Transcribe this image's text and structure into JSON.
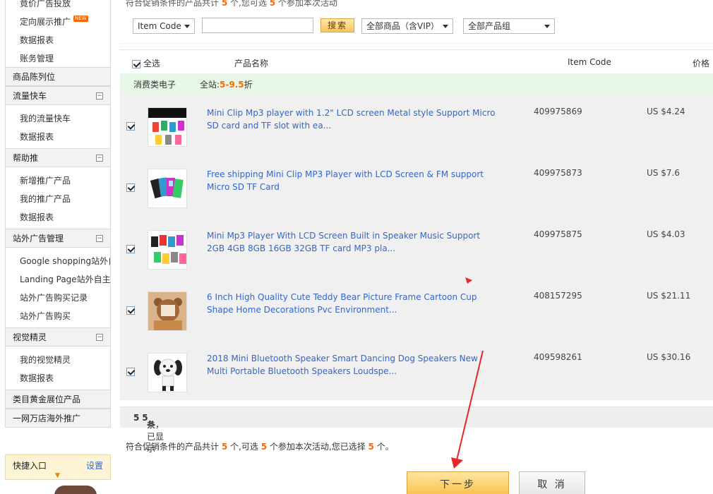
{
  "sidebar": {
    "top_items": [
      "竟价广告投放",
      "定向展示推广",
      "数据报表",
      "账务管理"
    ],
    "new_badge": "NEW",
    "section_goods": "商品陈列位",
    "section_flow": "流量快车",
    "flow_items": [
      "我的流量快车",
      "数据报表"
    ],
    "section_help": "帮助推",
    "help_items": [
      "新增推广产品",
      "我的推广产品",
      "数据报表"
    ],
    "section_offsite": "站外广告管理",
    "offsite_items": [
      "Google shopping站外自",
      "Landing Page站外自主",
      "站外广告购买记录",
      "站外广告购买"
    ],
    "section_visual": "视觉精灵",
    "visual_items": [
      "我的视觉精灵",
      "数据报表"
    ],
    "section_gold": "类目黄金展位产品",
    "section_global": "一网万店海外推广",
    "quick_title": "快捷入口",
    "quick_settings": "设置"
  },
  "top_text": {
    "pre": "符合促销条件的产品共计",
    "count1": "5",
    "mid": "个,您可选",
    "count2": "5",
    "post": "个参加本次活动"
  },
  "filter": {
    "item_code_label": "Item Code",
    "search_button": "搜索",
    "product_scope": "全部商品（含VIP）",
    "product_group": "全部产品组"
  },
  "table": {
    "header": {
      "select_all": "全选",
      "product_name": "产品名称",
      "item_code": "Item Code",
      "price": "价格"
    },
    "group": {
      "category": "消费类电子",
      "site_label": "全站:",
      "discount": "5-9.5",
      "discount_suffix": "折"
    },
    "rows": [
      {
        "name": "Mini Clip Mp3 player with 1.2\" LCD screen Metal style Support Micro SD card and TF slot with ea...",
        "code": "409975869",
        "price": "US $4.24"
      },
      {
        "name": "Free shipping Mini Clip MP3 Player with LCD Screen & FM support Micro SD TF Card",
        "code": "409975873",
        "price": "US $7.6"
      },
      {
        "name": "Mini Mp3 Player With LCD Screen Built in Speaker Music Support 2GB 4GB 8GB 16GB 32GB TF card MP3 pla...",
        "code": "409975875",
        "price": "US $4.03"
      },
      {
        "name": "6 Inch High Quality Cute Teddy Bear Picture Frame Cartoon Cup Shape Home Decorations Pvc Environment...",
        "code": "408157295",
        "price": "US $21.11"
      },
      {
        "name": "2018 Mini Bluetooth Speaker Smart Dancing Dog Speakers New Multi Portable Bluetooth Speakers Loudspe...",
        "code": "409598261",
        "price": "US $30.16"
      }
    ]
  },
  "summary": {
    "pre": "共",
    "total": "5",
    "mid": "条，已显示",
    "shown": "5",
    "post": "条"
  },
  "note": {
    "pre": "符合促销条件的产品共计",
    "count1": "5",
    "mid1": "个,可选",
    "count2": "5",
    "mid2": "个参加本次活动,您已选择",
    "count3": "5",
    "post": "个。"
  },
  "buttons": {
    "next": "下一步",
    "cancel": "取 消"
  },
  "colors": {
    "accent_orange": "#ff6600",
    "link_blue": "#3366cc",
    "annotation_red": "#e8262b",
    "group_row_bg": "#e7f7e7"
  }
}
